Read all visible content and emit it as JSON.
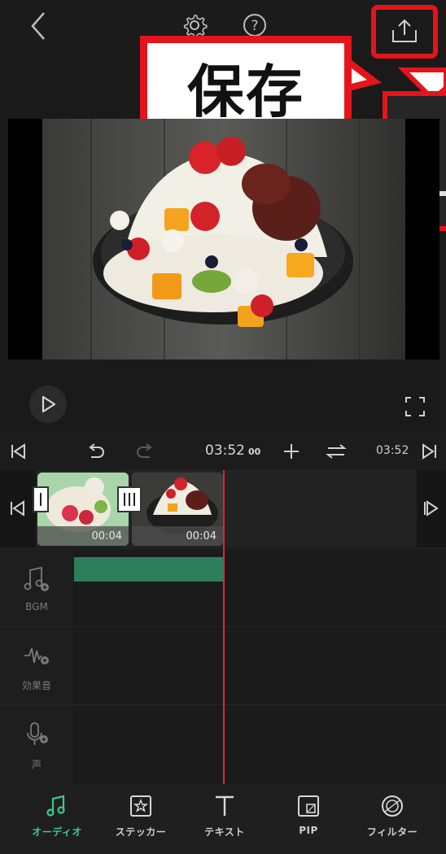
{
  "header": {
    "back_icon": "chevron-left-icon",
    "settings_icon": "gear-icon",
    "help_icon": "question-icon",
    "export_icon": "share-upload-icon"
  },
  "callout": {
    "text": "保存",
    "accent": "#e5141b"
  },
  "timeline_toolbar": {
    "current_time": "03:52",
    "current_frames": "00",
    "total_time": "03:52"
  },
  "clips": [
    {
      "duration": "00:04"
    },
    {
      "duration": "00:04"
    }
  ],
  "tracks": [
    {
      "label": "BGM",
      "icon": "music-note-add-icon"
    },
    {
      "label": "効果音",
      "icon": "sound-wave-add-icon"
    },
    {
      "label": "声",
      "icon": "microphone-add-icon"
    }
  ],
  "bottom_nav": [
    {
      "label": "オーディオ",
      "icon": "music-note-icon",
      "active": true
    },
    {
      "label": "ステッカー",
      "icon": "sticker-star-icon",
      "active": false
    },
    {
      "label": "テキスト",
      "icon": "text-t-icon",
      "active": false
    },
    {
      "label": "PIP",
      "icon": "pip-icon",
      "active": false
    },
    {
      "label": "フィルター",
      "icon": "filter-circles-icon",
      "active": false
    }
  ],
  "colors": {
    "accent_green": "#3ec98a",
    "playhead": "#e0223a",
    "bgm_track": "#2e7d5b"
  }
}
